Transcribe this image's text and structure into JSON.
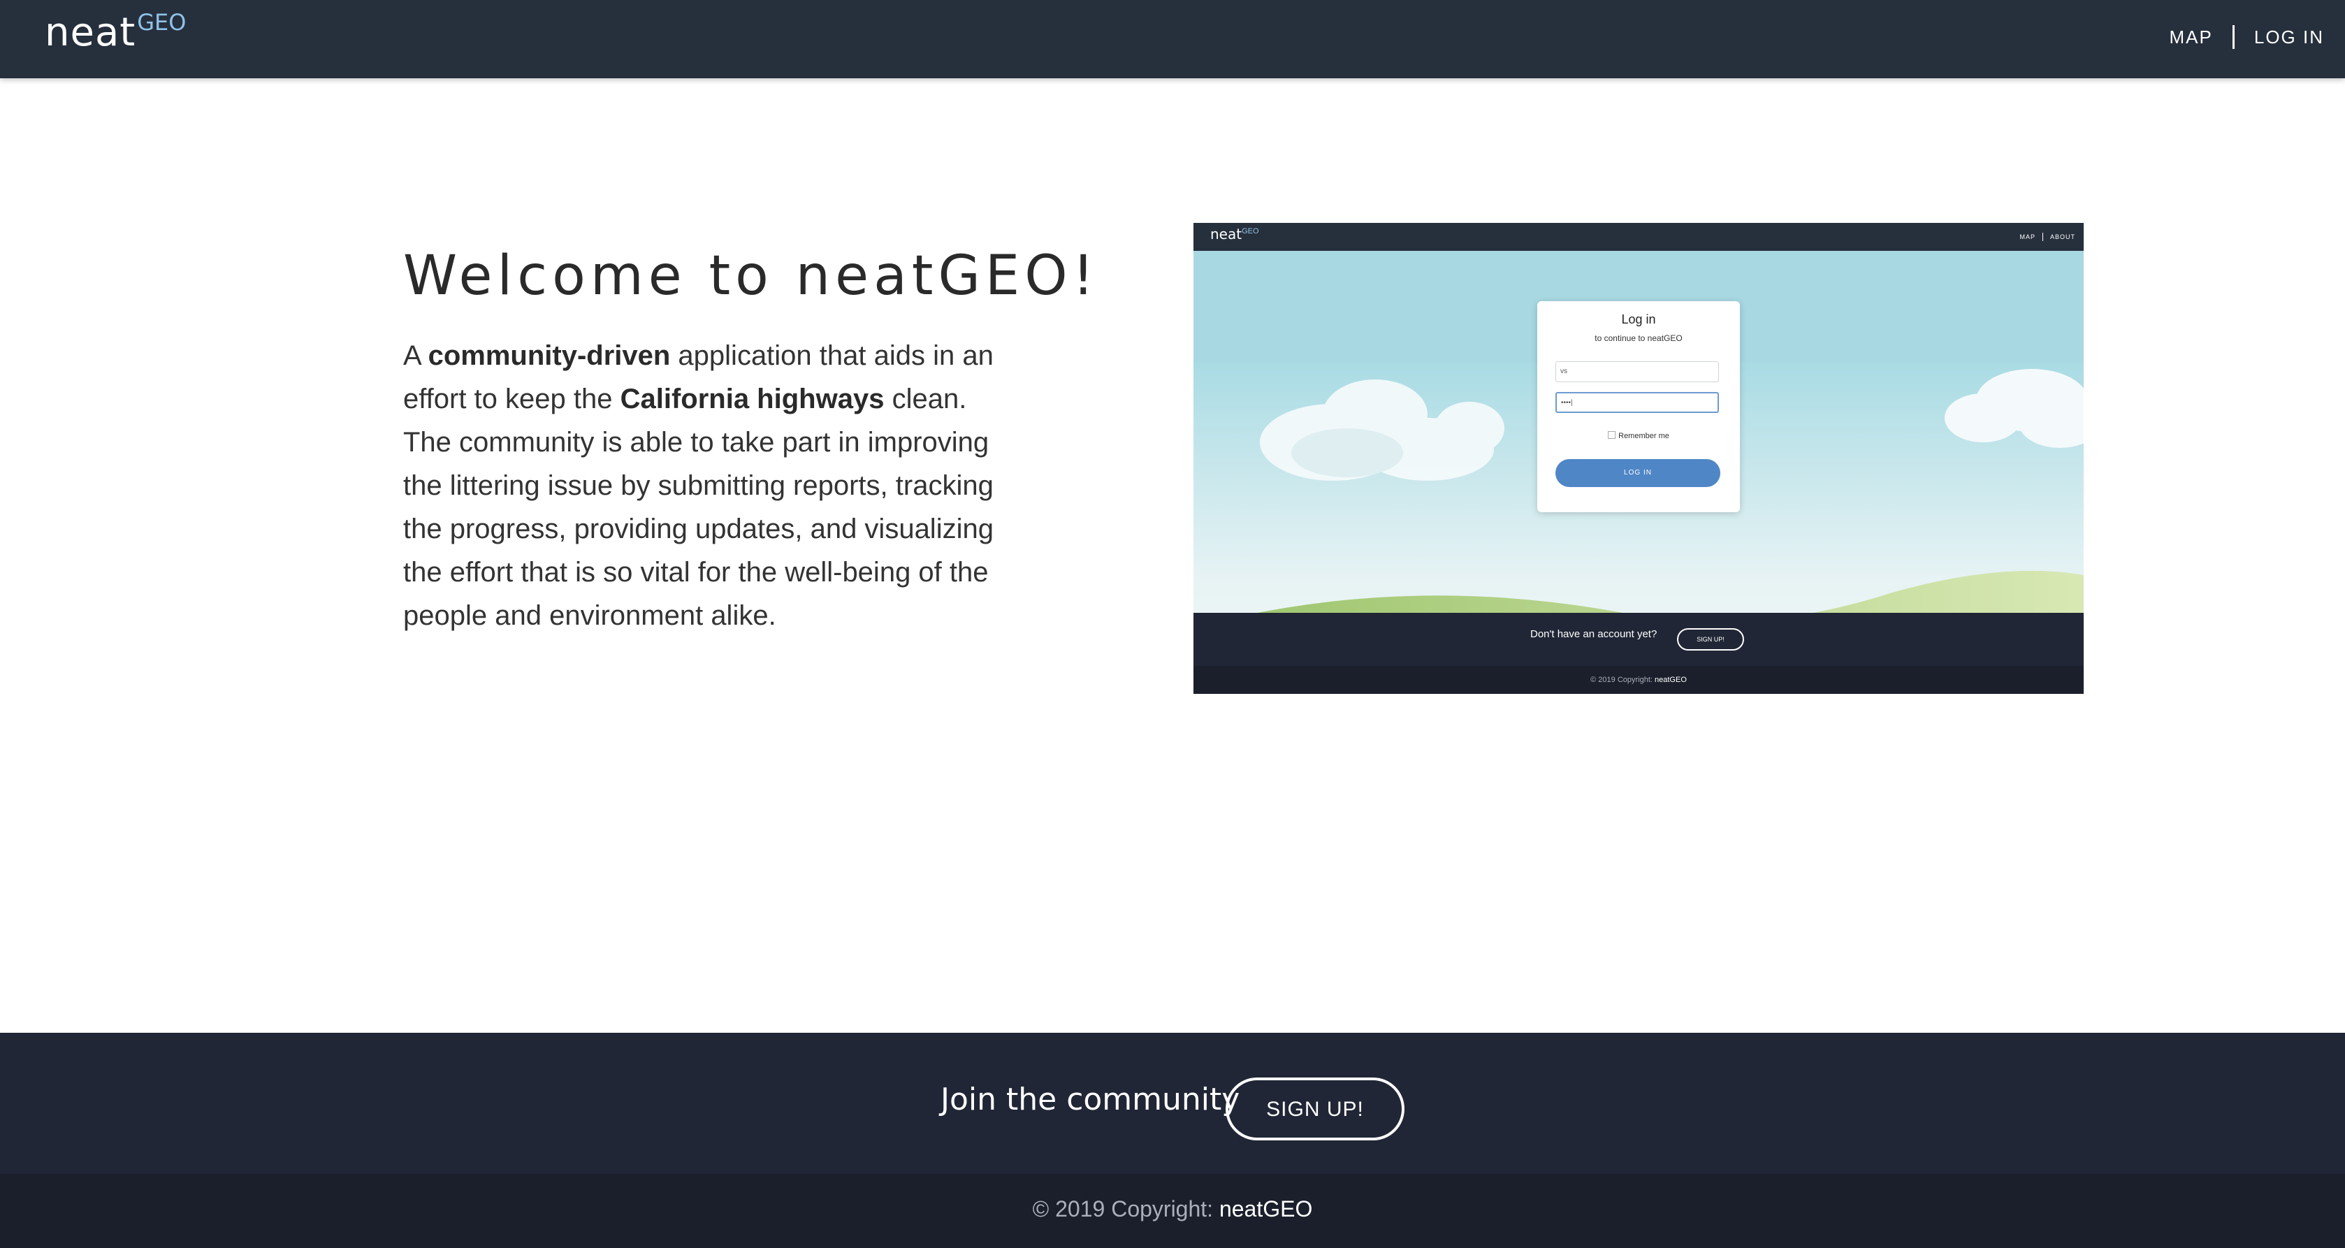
{
  "header": {
    "logo_word": "neat",
    "logo_sup": "GEO",
    "nav": {
      "map": "MAP",
      "login": "LOG IN"
    }
  },
  "hero": {
    "title": "Welcome to neatGEO!",
    "body": {
      "p1": "A ",
      "b1": "community-driven",
      "p2": " application that aids in an effort to keep the ",
      "b2": "California highways",
      "p3": " clean. The community is able to take part in improving the littering issue by submitting reports, tracking the progress, providing updates, and visualizing the effort that is so vital for the well-being of the people and environment alike."
    }
  },
  "preview": {
    "logo_word": "neat",
    "logo_sup": "GEO",
    "nav": {
      "map": "MAP",
      "about": "ABOUT"
    },
    "card": {
      "title": "Log in",
      "subtitle": "to continue to neatGEO",
      "username_value": "vs",
      "password_value": "••••|",
      "remember": "Remember me",
      "button": "LOG IN"
    },
    "footer": {
      "join": "Don't have an account yet?",
      "signup": "SIGN UP!"
    },
    "copyright": {
      "text": "© 2019 Copyright: ",
      "brand": "neatGEO"
    }
  },
  "footer": {
    "join": "Join the community",
    "signup": "SIGN UP!"
  },
  "copyright": {
    "text": "© 2019 Copyright: ",
    "brand": "neatGEO"
  },
  "colors": {
    "header_bg": "#262f3c",
    "footer_bg": "#202635",
    "copyright_bg": "#1a1f2b",
    "logo_accent": "#8fc3ea",
    "preview_button": "#4f86c6"
  }
}
